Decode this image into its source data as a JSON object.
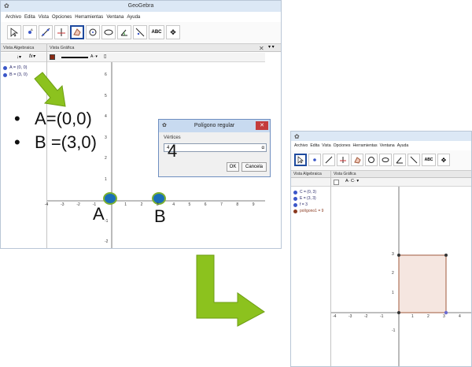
{
  "left_window": {
    "app_title": "GeoGebra",
    "menu": [
      "Archivo",
      "Edita",
      "Vista",
      "Opciones",
      "Herramientas",
      "Ventana",
      "Ayuda"
    ],
    "algebra_header": "Vista Algebraica",
    "graphics_header": "Vista Gráfica",
    "algebra_items": [
      "A = (0, 0)",
      "B = (3, 0)"
    ],
    "x_ticks": [
      "-4",
      "-3",
      "-2",
      "-1",
      "1",
      "2",
      "3",
      "4",
      "5",
      "6",
      "7",
      "8",
      "9"
    ],
    "y_ticks": [
      "6",
      "5",
      "4",
      "3",
      "2",
      "1",
      "-1",
      "-2"
    ]
  },
  "annotations": {
    "bullet1": "A=(0,0)",
    "bullet2": "B =(3,0)",
    "point_label_a": "A",
    "point_label_b": "B",
    "handwritten_value": "4"
  },
  "dialog": {
    "title": "Polígono regular",
    "field_label": "Vértices",
    "field_value": "4",
    "ok_label": "OK",
    "cancel_label": "Cancela"
  },
  "right_window": {
    "menu": [
      "Archivo",
      "Edita",
      "Vista",
      "Opciones",
      "Herramientas",
      "Ventana",
      "Ayuda"
    ],
    "algebra_header": "Vista Algebraica",
    "graphics_header": "Vista Gráfica",
    "algebra_items": [
      "C = (0, 3)",
      "E = (3, 3)",
      "f = 3",
      "polígono1 = 9"
    ],
    "x_ticks": [
      "-4",
      "-3",
      "-2",
      "-1",
      "1",
      "2",
      "3",
      "4"
    ],
    "y_ticks": [
      "3",
      "2",
      "1",
      "-1"
    ]
  },
  "colors": {
    "point_fill": "#1a6fb8",
    "point_ring": "#7bb030",
    "arrow_green": "#8cc21e",
    "polygon_fill": "#f5e6e0",
    "polygon_edge": "#a05a3c"
  }
}
